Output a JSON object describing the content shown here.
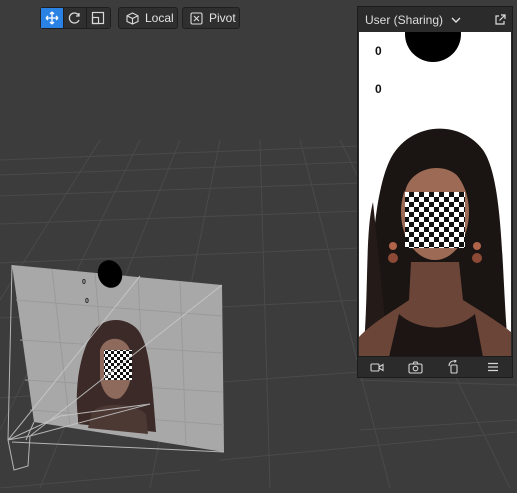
{
  "toolbar": {
    "tools": [
      {
        "icon": "move-icon",
        "active": true
      },
      {
        "icon": "rotate-icon",
        "active": false
      },
      {
        "icon": "scale-icon",
        "active": false
      }
    ],
    "space_label": "Local",
    "space_icon": "cube-icon",
    "pivot_label": "Pivot",
    "pivot_icon": "pivot-icon"
  },
  "scene": {
    "plane_counters": [
      "0",
      "0"
    ]
  },
  "preview": {
    "camera_label": "User (Sharing)",
    "overlay_counters": [
      "0",
      "0"
    ],
    "footer_icons": [
      "video-camera-icon",
      "switch-camera-icon",
      "rotate-device-icon",
      "menu-icon"
    ]
  },
  "colors": {
    "accent": "#2a82e4",
    "viewport_bg": "#3c3c3c",
    "panel_bg": "#2b2b2b"
  }
}
